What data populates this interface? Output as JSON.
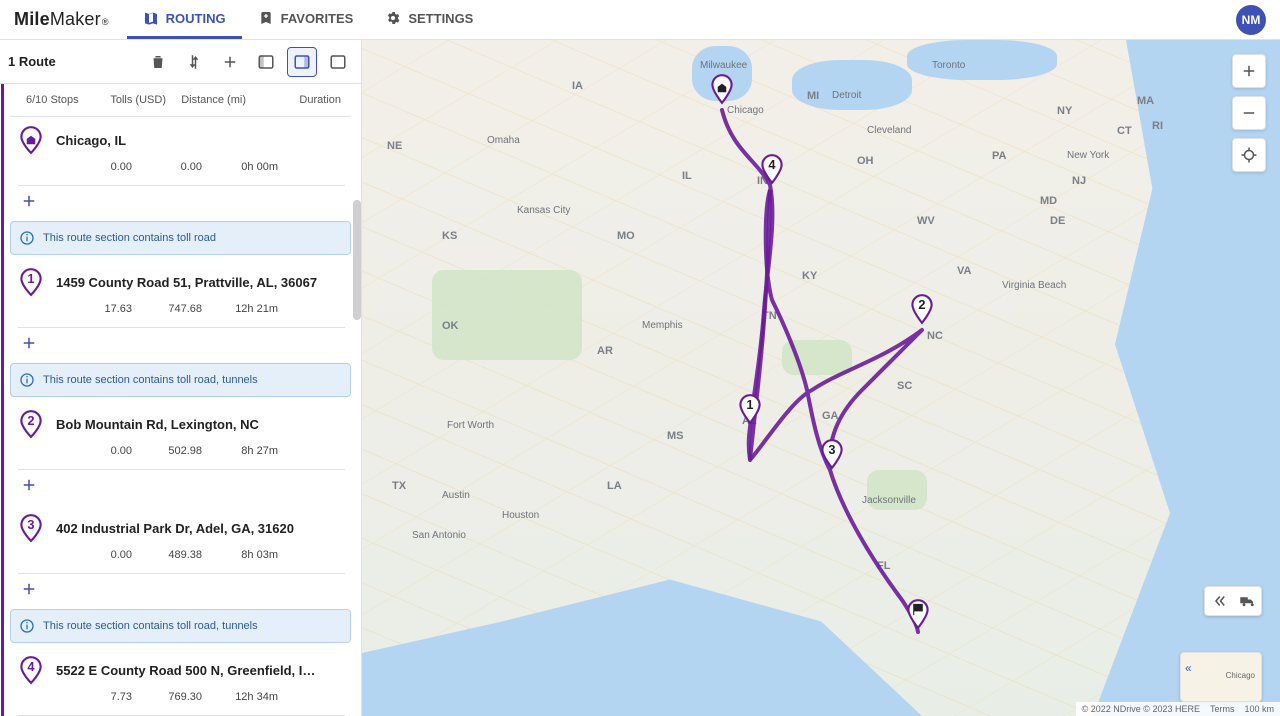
{
  "brand": {
    "part1": "Mile",
    "part2": "Maker",
    "reg": "®"
  },
  "nav": {
    "routing": "ROUTING",
    "favorites": "FAVORITES",
    "settings": "SETTINGS"
  },
  "avatar": "NM",
  "panel": {
    "route_count": "1 Route",
    "columns": {
      "stops": "6/10 Stops",
      "tolls": "Tolls (USD)",
      "distance": "Distance (mi)",
      "duration": "Duration"
    }
  },
  "banners": {
    "b1": "This route section contains toll road",
    "b2": "This route section contains toll road, tunnels",
    "b3": "This route section contains toll road, tunnels"
  },
  "stops": [
    {
      "label": "Chicago, IL",
      "toll": "0.00",
      "dist": "0.00",
      "dur": "0h 00m",
      "kind": "home"
    },
    {
      "label": "1459 County Road 51, Prattville, AL, 36067",
      "toll": "17.63",
      "dist": "747.68",
      "dur": "12h 21m",
      "kind": "1"
    },
    {
      "label": "Bob Mountain Rd, Lexington, NC",
      "toll": "0.00",
      "dist": "502.98",
      "dur": "8h 27m",
      "kind": "2"
    },
    {
      "label": "402 Industrial Park Dr, Adel, GA, 31620",
      "toll": "0.00",
      "dist": "489.38",
      "dur": "8h 03m",
      "kind": "3"
    },
    {
      "label": "5522 E County Road 500 N, Greenfield, I…",
      "toll": "7.73",
      "dist": "769.30",
      "dur": "12h 34m",
      "kind": "4"
    }
  ],
  "map": {
    "attribution": "© 2022 NDrive  © 2023 HERE",
    "terms": "Terms",
    "scale": "100 km",
    "mini_label": "Chicago",
    "cities": {
      "chicago": "Chicago",
      "milwaukee": "Milwaukee",
      "detroit": "Detroit",
      "toronto": "Toronto",
      "cleveland": "Cleveland",
      "newyork": "New York",
      "virginia_beach": "Virginia Beach",
      "kansas": "Kansas City",
      "omaha": "Omaha",
      "memphis": "Memphis",
      "fortworth": "Fort Worth",
      "austin": "Austin",
      "houston": "Houston",
      "sanantonio": "San Antonio",
      "jacksonville": "Jacksonville"
    },
    "states": {
      "IA": "IA",
      "NE": "NE",
      "KS": "KS",
      "OK": "OK",
      "TX": "TX",
      "MO": "MO",
      "AR": "AR",
      "LA": "LA",
      "MS": "MS",
      "IL": "IL",
      "IN": "IN",
      "OH": "OH",
      "MI": "MI",
      "KY": "KY",
      "TN": "TN",
      "AL": "AL",
      "GA": "GA",
      "SC": "SC",
      "NC": "NC",
      "VA": "VA",
      "WV": "WV",
      "PA": "PA",
      "NY": "NY",
      "MD": "MD",
      "DE": "DE",
      "NJ": "NJ",
      "CT": "CT",
      "MA": "MA",
      "RI": "RI",
      "FL": "FL"
    }
  }
}
